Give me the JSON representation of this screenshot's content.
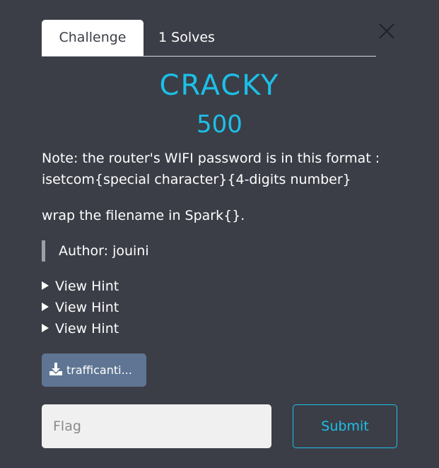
{
  "tabs": [
    {
      "label": "Challenge",
      "active": true
    },
    {
      "label": "1 Solves",
      "active": false
    }
  ],
  "challenge": {
    "name": "CRACKY",
    "value": "500",
    "description_lines": [
      "Note: the router's WIFI password is in this format :",
      "isetcom{special character}{4-digits number}"
    ],
    "instruction": "wrap the filename in Spark{}.",
    "author": "Author: jouini"
  },
  "hints": [
    {
      "label": "View Hint"
    },
    {
      "label": "View Hint"
    },
    {
      "label": "View Hint"
    }
  ],
  "file": {
    "label": "trafficanti...",
    "icon": "download-icon"
  },
  "flag_input": {
    "placeholder": "Flag",
    "value": ""
  },
  "submit_label": "Submit",
  "colors": {
    "background": "#3b3e47",
    "accent": "#1cc0e8",
    "file_button": "#5f7593"
  }
}
